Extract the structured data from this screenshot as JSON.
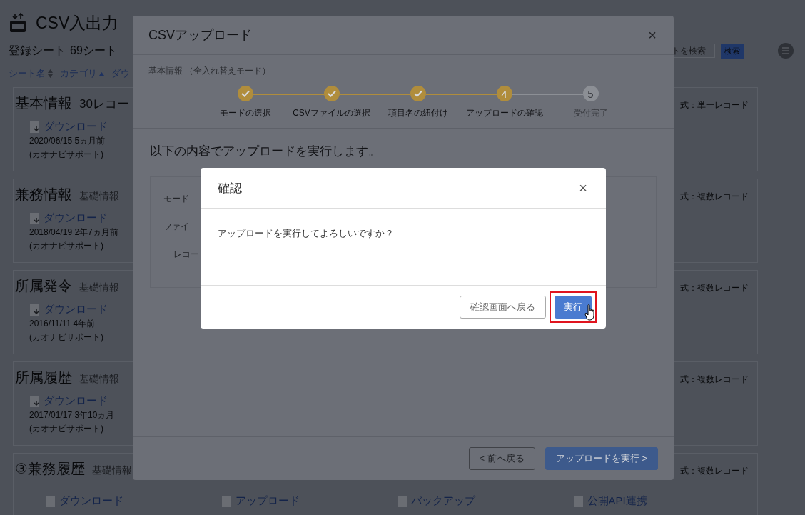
{
  "page": {
    "title": "CSV入出力",
    "sheet_count_label": "登録シート",
    "sheet_count": "69シート",
    "search": {
      "placeholder": "トを検索",
      "button": "検索"
    },
    "sort_columns": [
      {
        "label": "シート名",
        "sorted": false
      },
      {
        "label": "カテゴリ",
        "sorted": true
      },
      {
        "label": "ダウ"
      }
    ],
    "sheets": [
      {
        "title": "基本情報",
        "records": "30レコー",
        "format": "式：単一レコード",
        "download": "ダウンロード",
        "date": "2020/06/15 5ヵ月前",
        "user": "(カオナビサポート)"
      },
      {
        "title": "兼務情報",
        "category": "基礎情報",
        "format": "式：複数レコード",
        "download": "ダウンロード",
        "date": "2018/04/19 2年7ヵ月前",
        "user": "(カオナビサポート)"
      },
      {
        "title": "所属発令",
        "category": "基礎情報",
        "format": "式：複数レコード",
        "download": "ダウンロード",
        "date": "2016/11/11 4年前",
        "user": "(カオナビサポート)"
      },
      {
        "title": "所属履歴",
        "category": "基礎情報",
        "format": "式：複数レコード",
        "download": "ダウンロード",
        "date": "2017/01/17 3年10ヵ月",
        "user": "(カオナビサポート)"
      },
      {
        "title": "③兼務履歴",
        "category": "基礎情報",
        "format": "式：複数レコード",
        "actions": [
          "ダウンロード",
          "アップロード",
          "バックアップ",
          "公開API連携"
        ]
      }
    ]
  },
  "upload_modal": {
    "title": "CSVアップロード",
    "close": "×",
    "subtitle": "基本情報 （全入れ替えモード）",
    "steps": [
      {
        "label": "モードの選択",
        "done": true
      },
      {
        "label": "CSVファイルの選択",
        "done": true
      },
      {
        "label": "項目名の紐付け",
        "done": true
      },
      {
        "label": "アップロードの確認",
        "done": false,
        "current": true,
        "number": "4"
      },
      {
        "label": "受付完了",
        "done": false,
        "current": false,
        "number": "5"
      }
    ],
    "intro": "以下の内容でアップロードを実行します。",
    "fields": [
      "モード",
      "ファイ",
      "レコー"
    ],
    "back_button": "< 前へ戻る",
    "submit_button": "アップロードを実行 >"
  },
  "confirm_dialog": {
    "title": "確認",
    "close": "×",
    "message": "アップロードを実行してよろしいですか？",
    "cancel_button": "確認画面へ戻る",
    "ok_button": "実行",
    "ok_highlighted": true
  }
}
